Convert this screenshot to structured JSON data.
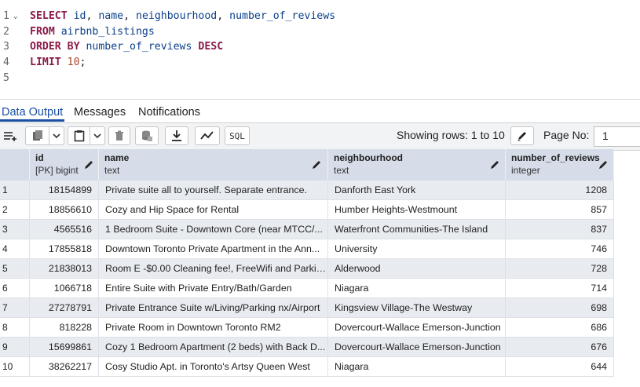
{
  "editor": {
    "lines": [
      {
        "num": "1",
        "parts": [
          [
            "kw",
            "SELECT "
          ],
          [
            "id",
            "id"
          ],
          [
            "plain",
            ", "
          ],
          [
            "id",
            "name"
          ],
          [
            "plain",
            ", "
          ],
          [
            "id",
            "neighbourhood"
          ],
          [
            "plain",
            ", "
          ],
          [
            "id",
            "number_of_reviews"
          ]
        ]
      },
      {
        "num": "2",
        "parts": [
          [
            "kw",
            "FROM "
          ],
          [
            "id",
            "airbnb_listings"
          ]
        ]
      },
      {
        "num": "3",
        "parts": [
          [
            "kw",
            "ORDER BY "
          ],
          [
            "id",
            "number_of_reviews "
          ],
          [
            "kw",
            "DESC"
          ]
        ]
      },
      {
        "num": "4",
        "parts": [
          [
            "kw",
            "LIMIT "
          ],
          [
            "numlit",
            "10"
          ],
          [
            "plain",
            ";"
          ]
        ]
      },
      {
        "num": "5",
        "parts": []
      }
    ]
  },
  "tabs": {
    "data_output": "Data Output",
    "messages": "Messages",
    "notifications": "Notifications"
  },
  "toolbar": {
    "sql_label": "SQL",
    "rows_text": "Showing rows: 1 to 10",
    "page_label": "Page No:",
    "page_value": "1"
  },
  "grid": {
    "columns": [
      {
        "name": "id",
        "type": "[PK] bigint"
      },
      {
        "name": "name",
        "type": "text"
      },
      {
        "name": "neighbourhood",
        "type": "text"
      },
      {
        "name": "number_of_reviews",
        "type": "integer"
      }
    ],
    "rows": [
      {
        "n": "1",
        "id": "18154899",
        "name": "Private suite all to yourself. Separate entrance.",
        "nb": "Danforth East York",
        "rev": "1208"
      },
      {
        "n": "2",
        "id": "18856610",
        "name": "Cozy and Hip Space for Rental",
        "nb": "Humber Heights-Westmount",
        "rev": "857"
      },
      {
        "n": "3",
        "id": "4565516",
        "name": "1 Bedroom Suite - Downtown Core (near MTCC/...",
        "nb": "Waterfront Communities-The Island",
        "rev": "837"
      },
      {
        "n": "4",
        "id": "17855818",
        "name": "Downtown Toronto Private Apartment in the Ann...",
        "nb": "University",
        "rev": "746"
      },
      {
        "n": "5",
        "id": "21838013",
        "name": "Room E -$0.00 Cleaning fee!, FreeWifi and Parkin...",
        "nb": "Alderwood",
        "rev": "728"
      },
      {
        "n": "6",
        "id": "1066718",
        "name": "Entire Suite with Private Entry/Bath/Garden",
        "nb": "Niagara",
        "rev": "714"
      },
      {
        "n": "7",
        "id": "27278791",
        "name": "Private Entrance Suite w/Living/Parking nx/Airport",
        "nb": "Kingsview Village-The Westway",
        "rev": "698"
      },
      {
        "n": "8",
        "id": "818228",
        "name": "Private Room in Downtown Toronto RM2",
        "nb": "Dovercourt-Wallace Emerson-Junction",
        "rev": "686"
      },
      {
        "n": "9",
        "id": "15699861",
        "name": "Cozy 1 Bedroom Apartment (2 beds) with Back D...",
        "nb": "Dovercourt-Wallace Emerson-Junction",
        "rev": "676"
      },
      {
        "n": "10",
        "id": "38262217",
        "name": "Cosy Studio Apt. in Toronto's Artsy Queen West",
        "nb": "Niagara",
        "rev": "644"
      }
    ]
  }
}
